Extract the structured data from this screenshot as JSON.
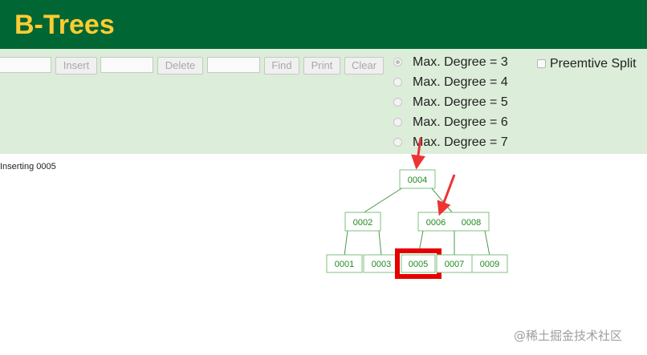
{
  "header": {
    "title": "B-Trees",
    "bg_color": "#006633",
    "title_color": "#FFCC33"
  },
  "controls": {
    "bg_color": "#DCEDD9",
    "insert_input_value": "",
    "insert_label": "Insert",
    "delete_input_value": "",
    "delete_label": "Delete",
    "find_input_value": "",
    "find_label": "Find",
    "print_label": "Print",
    "clear_label": "Clear",
    "degree_options": [
      {
        "label": "Max. Degree = 3",
        "selected": true
      },
      {
        "label": "Max. Degree = 4",
        "selected": false
      },
      {
        "label": "Max. Degree = 5",
        "selected": false
      },
      {
        "label": "Max. Degree = 6",
        "selected": false
      },
      {
        "label": "Max. Degree = 7",
        "selected": false
      }
    ],
    "preemptive_split_label": "Preemtive Split",
    "preemptive_split_checked": false
  },
  "canvas": {
    "status_text": "Inserting 0005",
    "tree": {
      "root": [
        "0004"
      ],
      "level1": [
        [
          "0002"
        ],
        [
          "0006",
          "0008"
        ]
      ],
      "leaves": [
        [
          "0001"
        ],
        [
          "0003"
        ],
        [
          "0005"
        ],
        [
          "0007"
        ],
        [
          "0009"
        ]
      ]
    },
    "highlighted_key": "0005",
    "node_color": "#1f8a1f",
    "highlight_color": "#e60000",
    "arrow_color": "#ee3333"
  },
  "watermark": "@稀土掘金技术社区"
}
